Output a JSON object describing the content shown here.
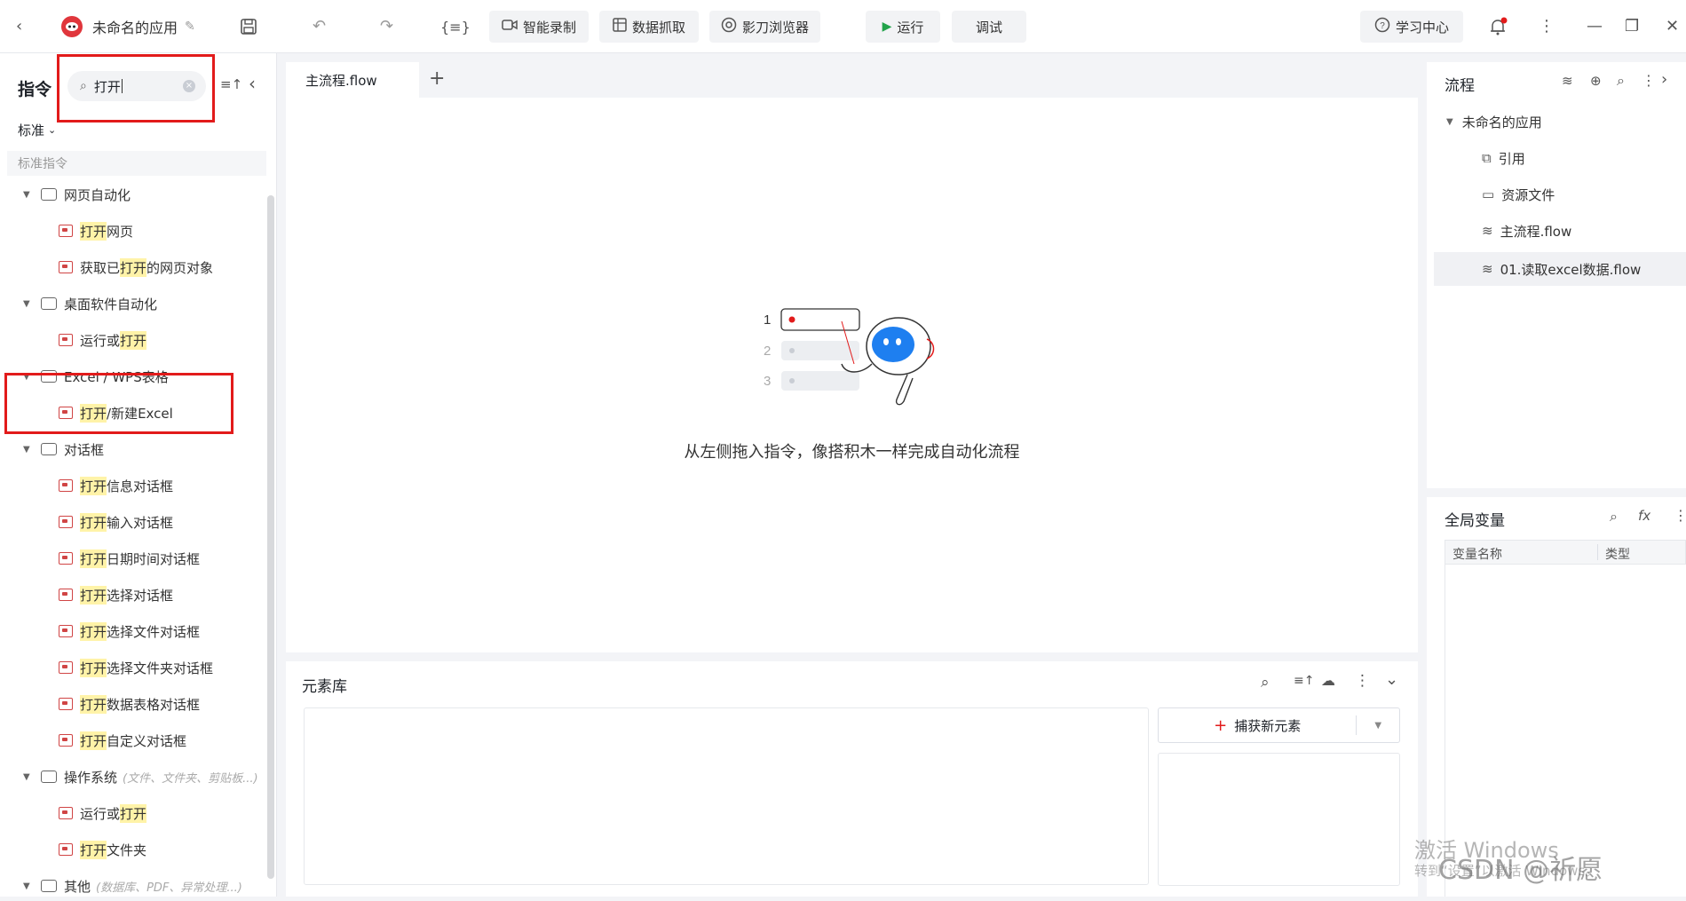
{
  "topbar": {
    "app_name": "未命名的应用",
    "smart_record": "智能录制",
    "data_capture": "数据抓取",
    "browser": "影刀浏览器",
    "run": "运行",
    "debug": "调试",
    "learn_center": "学习中心"
  },
  "left_panel": {
    "title": "指令",
    "search_value": "打开",
    "filter_label": "标准",
    "section_label": "标准指令",
    "categories": [
      {
        "label": "网页自动化",
        "items": [
          {
            "pre": "",
            "hl": "打开",
            "post": "网页"
          },
          {
            "pre": "获取已",
            "hl": "打开",
            "post": "的网页对象"
          }
        ]
      },
      {
        "label": "桌面软件自动化",
        "items": [
          {
            "pre": "运行或",
            "hl": "打开",
            "post": ""
          }
        ]
      },
      {
        "label": "Excel / WPS表格",
        "items": [
          {
            "pre": "",
            "hl": "打开",
            "post": "/新建Excel"
          }
        ]
      },
      {
        "label": "对话框",
        "items": [
          {
            "pre": "",
            "hl": "打开",
            "post": "信息对话框"
          },
          {
            "pre": "",
            "hl": "打开",
            "post": "输入对话框"
          },
          {
            "pre": "",
            "hl": "打开",
            "post": "日期时间对话框"
          },
          {
            "pre": "",
            "hl": "打开",
            "post": "选择对话框"
          },
          {
            "pre": "",
            "hl": "打开",
            "post": "选择文件对话框"
          },
          {
            "pre": "",
            "hl": "打开",
            "post": "选择文件夹对话框"
          },
          {
            "pre": "",
            "hl": "打开",
            "post": "数据表格对话框"
          },
          {
            "pre": "",
            "hl": "打开",
            "post": "自定义对话框"
          }
        ]
      },
      {
        "label": "操作系统",
        "hint": "(文件、文件夹、剪贴板...)",
        "items": [
          {
            "pre": "运行或",
            "hl": "打开",
            "post": ""
          },
          {
            "pre": "",
            "hl": "打开",
            "post": "文件夹"
          }
        ]
      },
      {
        "label": "其他",
        "hint": "(数据库、PDF、异常处理...)",
        "items": []
      }
    ]
  },
  "editor": {
    "tab_label": "主流程.flow",
    "empty_hint": "从左侧拖入指令，像搭积木一样完成自动化流程",
    "illustration_numbers": [
      "1",
      "2",
      "3"
    ]
  },
  "element_lib": {
    "title": "元素库",
    "capture_button": "捕获新元素"
  },
  "flow_panel": {
    "title": "流程",
    "root": "未命名的应用",
    "items": [
      "引用",
      "资源文件",
      "主流程.flow",
      "01.读取excel数据.flow"
    ]
  },
  "vars_panel": {
    "title": "全局变量",
    "col_name": "变量名称",
    "col_type": "类型"
  },
  "watermark": {
    "line1": "激活 Windows",
    "line2": "转到“设置”以激活 Windows。",
    "csdn": "CSDN @祈愿"
  }
}
